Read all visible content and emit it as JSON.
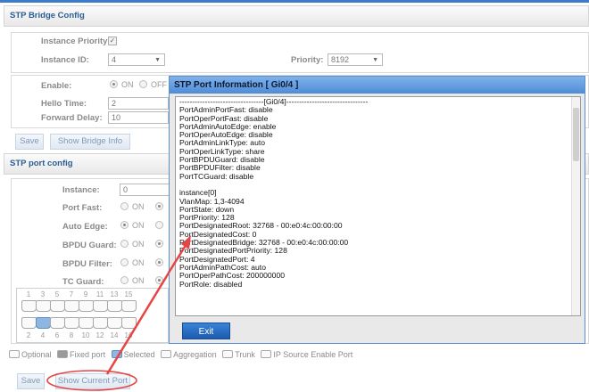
{
  "bridge": {
    "title": "STP Bridge Config",
    "instance_priority_label": "Instance Priority:",
    "instance_id_label": "Instance ID:",
    "instance_id_value": "4",
    "priority_label": "Priority:",
    "priority_value": "8192",
    "enable_label": "Enable:",
    "on_label": "ON",
    "off_label": "OFF",
    "hello_time_label": "Hello Time:",
    "hello_time_value": "2",
    "forward_delay_label": "Forward Delay:",
    "forward_delay_value": "10",
    "save_label": "Save",
    "show_info_label": "Show Bridge Info"
  },
  "port_config": {
    "title": "STP port config",
    "instance_label": "Instance:",
    "instance_value": "0",
    "port_fast_label": "Port Fast:",
    "auto_edge_label": "Auto Edge:",
    "bpdu_guard_label": "BPDU Guard:",
    "bpdu_filter_label": "BPDU Filter:",
    "tc_guard_label": "TC Guard:",
    "on_label": "ON",
    "top_port_numbers": [
      "1",
      "3",
      "5",
      "7",
      "9",
      "11",
      "13",
      "15"
    ],
    "bottom_port_numbers": [
      "2",
      "4",
      "6",
      "8",
      "10",
      "12",
      "14",
      "16"
    ],
    "save_label": "Save",
    "show_current_label": "Show Current Port"
  },
  "legend": {
    "optional": "Optional",
    "fixed": "Fixed port",
    "selected": "Selected",
    "aggregation": "Aggregation",
    "trunk": "Trunk",
    "ip_source": "IP Source Enable Port"
  },
  "popup": {
    "title": "STP Port Information [ Gi0/4 ]",
    "lines": [
      "---------------------------------[Gi0/4]--------------------------------",
      "PortAdminPortFast: disable",
      "PortOperPortFast: disable",
      "PortAdminAutoEdge: enable",
      "PortOperAutoEdge: disable",
      "PortAdminLinkType: auto",
      "PortOperLinkType: share",
      "PortBPDUGuard: disable",
      "PortBPDUFilter: disable",
      "PortTCGuard: disable",
      "",
      "instance[0]",
      "VlanMap: 1,3-4094",
      "PortState: down",
      "PortPriority: 128",
      "PortDesignatedRoot: 32768 - 00:e0:4c:00:00:00",
      "PortDesignatedCost: 0",
      "PortDesignatedBridge: 32768 - 00:e0:4c:00:00:00",
      "PortDesignatedPortPriority: 128",
      "PortDesignatedPort: 4",
      "PortAdminPathCost: auto",
      "PortOperPathCost: 200000000",
      "PortRole: disabled"
    ],
    "exit_label": "Exit"
  },
  "colors": {
    "accent": "#3d7cc9",
    "annotation": "#e64545"
  }
}
